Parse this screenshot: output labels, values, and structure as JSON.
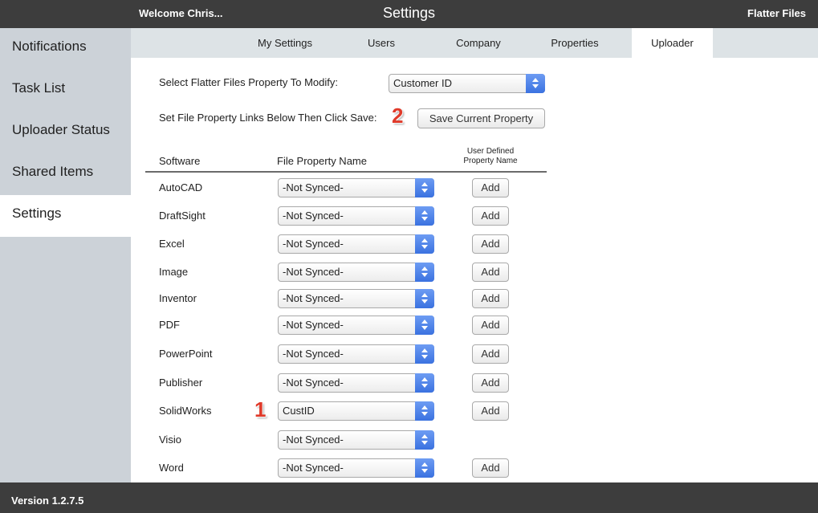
{
  "header": {
    "welcome": "Welcome Chris...",
    "title": "Settings",
    "brand": "Flatter Files"
  },
  "sidebar": {
    "items": [
      {
        "label": "Notifications",
        "active": false
      },
      {
        "label": "Task List",
        "active": false
      },
      {
        "label": "Uploader Status",
        "active": false
      },
      {
        "label": "Shared Items",
        "active": false
      },
      {
        "label": "Settings",
        "active": true
      }
    ]
  },
  "tabs": [
    {
      "label": "My Settings",
      "active": false
    },
    {
      "label": "Users",
      "active": false
    },
    {
      "label": "Company",
      "active": false
    },
    {
      "label": "Properties",
      "active": false
    },
    {
      "label": "Uploader",
      "active": true
    }
  ],
  "form": {
    "select_label": "Select Flatter Files Property To Modify:",
    "property_value": "Customer ID",
    "save_instruction": "Set File Property Links Below Then Click Save:",
    "save_button": "Save Current Property"
  },
  "markers": {
    "one": "1",
    "two": "2"
  },
  "table": {
    "col_software": "Software",
    "col_property": "File Property Name",
    "col_user_defined_1": "User Defined",
    "col_user_defined_2": "Property Name",
    "add_label": "Add",
    "rows": [
      {
        "software": "AutoCAD",
        "property": "-Not Synced-",
        "has_add": true
      },
      {
        "software": "DraftSight",
        "property": "-Not Synced-",
        "has_add": true
      },
      {
        "software": "Excel",
        "property": "-Not Synced-",
        "has_add": true
      },
      {
        "software": "Image",
        "property": "-Not Synced-",
        "has_add": true
      },
      {
        "software": "Inventor",
        "property": "-Not Synced-",
        "has_add": true
      },
      {
        "software": "PDF",
        "property": "-Not Synced-",
        "has_add": true
      },
      {
        "software": "PowerPoint",
        "property": "-Not Synced-",
        "has_add": true
      },
      {
        "software": "Publisher",
        "property": "-Not Synced-",
        "has_add": true
      },
      {
        "software": "SolidWorks",
        "property": "CustID",
        "has_add": true
      },
      {
        "software": "Visio",
        "property": "-Not Synced-",
        "has_add": false
      },
      {
        "software": "Word",
        "property": "-Not Synced-",
        "has_add": true
      }
    ]
  },
  "footer": {
    "version": "Version 1.2.7.5"
  },
  "colors": {
    "topbar": "#3d3d3d",
    "sidebar": "#ccd2d8",
    "tabbar": "#dde3e6",
    "select_arrow": "#3b72e0",
    "marker": "#e03a2a"
  }
}
